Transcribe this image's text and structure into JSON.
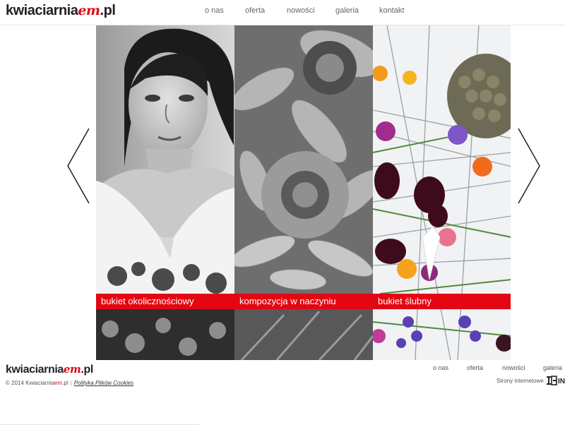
{
  "header": {
    "logo": {
      "text": "kwiaciarnia",
      "accent": "em",
      "suffix": ".pl"
    },
    "nav": [
      {
        "label": "o nas"
      },
      {
        "label": "oferta"
      },
      {
        "label": "nowości"
      },
      {
        "label": "galeria"
      },
      {
        "label": "kontakt"
      }
    ]
  },
  "slider": {
    "panels": [
      {
        "caption": "bukiet okolicznościowy"
      },
      {
        "caption": "kompozycja w naczyniu"
      },
      {
        "caption": "bukiet ślubny"
      }
    ],
    "prev_icon": "chevron-left-icon",
    "next_icon": "chevron-right-icon"
  },
  "footer": {
    "logo": {
      "text": "kwiaciarnia",
      "accent": "em",
      "suffix": ".pl"
    },
    "nav": [
      {
        "label": "o nas"
      },
      {
        "label": "oferta"
      },
      {
        "label": "nowości"
      },
      {
        "label": "galeria"
      }
    ],
    "copyright": {
      "prefix": "© 2014 Kwiaciarnia",
      "accent": "em",
      "suffix": ".pl",
      "separator": "|",
      "cookies_link": "Polityka Plików Cookies"
    },
    "credit": {
      "text": "Strony internetowe",
      "logo_text": "IN"
    }
  },
  "colors": {
    "accent": "#e30613",
    "text": "#222222",
    "nav": "#666666"
  }
}
